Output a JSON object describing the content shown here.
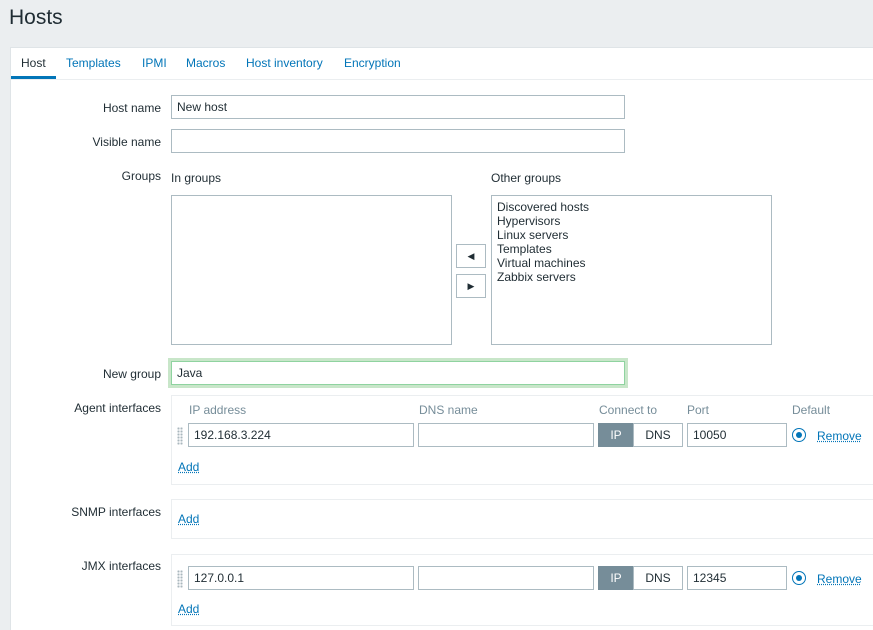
{
  "page": {
    "title": "Hosts"
  },
  "tabs": [
    {
      "label": "Host"
    },
    {
      "label": "Templates"
    },
    {
      "label": "IPMI"
    },
    {
      "label": "Macros"
    },
    {
      "label": "Host inventory"
    },
    {
      "label": "Encryption"
    }
  ],
  "form": {
    "host_name": {
      "label": "Host name",
      "value": "New host"
    },
    "visible_name": {
      "label": "Visible name",
      "value": ""
    },
    "groups": {
      "label": "Groups",
      "in_groups_label": "In groups",
      "in_groups": [],
      "other_groups_label": "Other groups",
      "other_groups": [
        "Discovered hosts",
        "Hypervisors",
        "Linux servers",
        "Templates",
        "Virtual machines",
        "Zabbix servers"
      ],
      "move_left_icon": "triangle-left-icon",
      "move_right_icon": "triangle-right-icon"
    },
    "new_group": {
      "label": "New group",
      "value": "Java"
    },
    "agent_interfaces": {
      "label": "Agent interfaces",
      "columns": {
        "ip": "IP address",
        "dns": "DNS name",
        "connect_to": "Connect to",
        "port": "Port",
        "default": "Default"
      },
      "row": {
        "ip": "192.168.3.224",
        "dns": "",
        "connect_ip": "IP",
        "connect_dns": "DNS",
        "port": "10050",
        "remove": "Remove"
      },
      "add": "Add"
    },
    "snmp_interfaces": {
      "label": "SNMP interfaces",
      "add": "Add"
    },
    "jmx_interfaces": {
      "label": "JMX interfaces",
      "row": {
        "ip": "127.0.0.1",
        "dns": "",
        "connect_ip": "IP",
        "connect_dns": "DNS",
        "port": "12345",
        "remove": "Remove"
      },
      "add": "Add"
    }
  },
  "colors": {
    "accent": "#0275b8",
    "segment_active": "#768d99",
    "focus_outline": "#c8e6c9"
  }
}
